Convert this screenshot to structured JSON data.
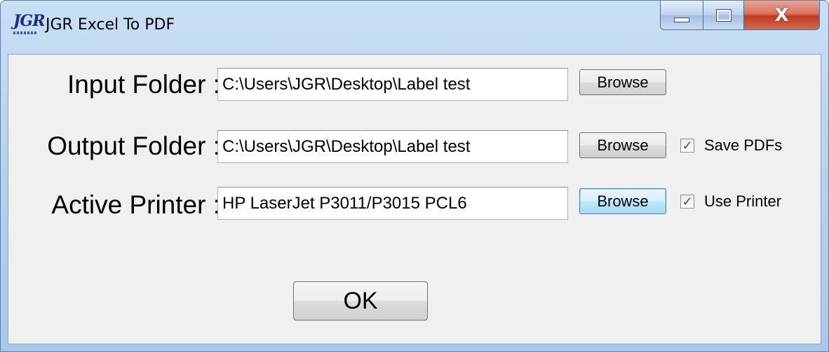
{
  "window": {
    "title": "JGR Excel To PDF",
    "logo_text": "JGR",
    "controls": {
      "minimize_icon": "minimize-icon",
      "maximize_icon": "maximize-icon",
      "close_icon": "close-icon",
      "close_glyph": "X"
    }
  },
  "form": {
    "input_folder": {
      "label": "Input Folder :",
      "value": "C:\\Users\\JGR\\Desktop\\Label test",
      "browse_label": "Browse"
    },
    "output_folder": {
      "label": "Output Folder :",
      "value": "C:\\Users\\JGR\\Desktop\\Label test",
      "browse_label": "Browse",
      "checkbox_label": "Save PDFs",
      "checked": true
    },
    "active_printer": {
      "label": "Active Printer :",
      "value": "HP LaserJet P3011/P3015 PCL6",
      "browse_label": "Browse",
      "checkbox_label": "Use Printer",
      "checked": true
    },
    "ok_label": "OK",
    "check_glyph": "✓"
  },
  "colors": {
    "titlebar": "#b7d2ee",
    "close_button": "#c0391f",
    "client_bg": "#f0f0f0",
    "checkmark": "#3a4f9e"
  }
}
